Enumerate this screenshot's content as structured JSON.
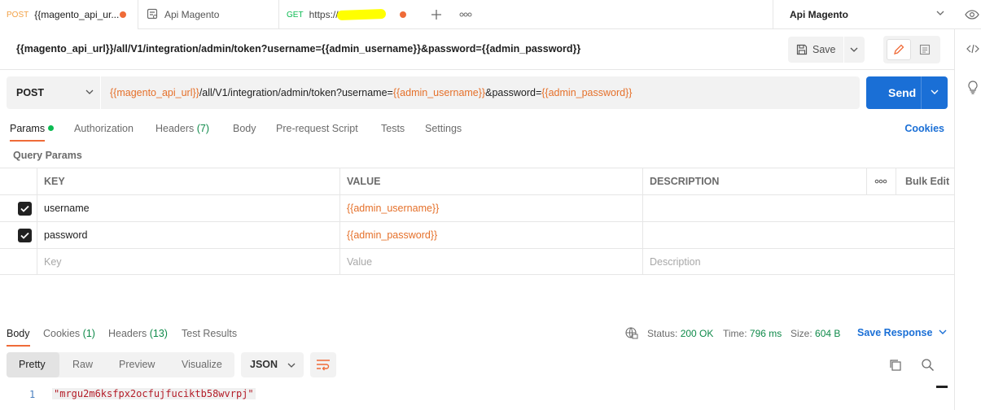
{
  "tabs": [
    {
      "method": "POST",
      "title": "{{magento_api_ur..."
    },
    {
      "title": "Api Magento"
    },
    {
      "method": "GET",
      "title": "https://"
    }
  ],
  "environment": {
    "name": "Api Magento"
  },
  "request_title": "{{magento_api_url}}/all/V1/integration/admin/token?username={{admin_username}}&password={{admin_password}}",
  "toolbar": {
    "save_label": "Save"
  },
  "url_bar": {
    "method": "POST",
    "url_parts": [
      {
        "text": "{{magento_api_url}}",
        "var": true
      },
      {
        "text": "/all/V1/integration/admin/token?username=",
        "var": false
      },
      {
        "text": "{{admin_username}}",
        "var": true
      },
      {
        "text": "&password=",
        "var": false
      },
      {
        "text": "{{admin_password}}",
        "var": true
      }
    ],
    "send_label": "Send"
  },
  "request_tabs": [
    {
      "label": "Params"
    },
    {
      "label": "Authorization"
    },
    {
      "label": "Headers",
      "count": "(7)"
    },
    {
      "label": "Body"
    },
    {
      "label": "Pre-request Script"
    },
    {
      "label": "Tests"
    },
    {
      "label": "Settings"
    }
  ],
  "cookies_link": "Cookies",
  "query_params": {
    "title": "Query Params",
    "headers": {
      "key": "KEY",
      "value": "VALUE",
      "description": "DESCRIPTION",
      "bulk_edit": "Bulk Edit"
    },
    "rows": [
      {
        "key": "username",
        "value": "{{admin_username}}",
        "checked": true
      },
      {
        "key": "password",
        "value": "{{admin_password}}",
        "checked": true
      }
    ],
    "placeholders": {
      "key": "Key",
      "value": "Value",
      "description": "Description"
    }
  },
  "response": {
    "tabs": [
      {
        "label": "Body"
      },
      {
        "label": "Cookies",
        "count": "(1)"
      },
      {
        "label": "Headers",
        "count": "(13)"
      },
      {
        "label": "Test Results"
      }
    ],
    "status_label": "Status:",
    "status_value": "200 OK",
    "time_label": "Time:",
    "time_value": "796 ms",
    "size_label": "Size:",
    "size_value": "604 B",
    "save_response": "Save Response",
    "views": [
      "Pretty",
      "Raw",
      "Preview",
      "Visualize"
    ],
    "format": "JSON",
    "line_number": "1",
    "body": "\"mrgu2m6ksfpx2ocfujfuciktb58wvrpj\""
  },
  "colors": {
    "accent": "#ef6b38",
    "send": "#1a6fd6",
    "variable": "#e5702a",
    "success": "#0f8a4a",
    "string": "#b41d28"
  }
}
